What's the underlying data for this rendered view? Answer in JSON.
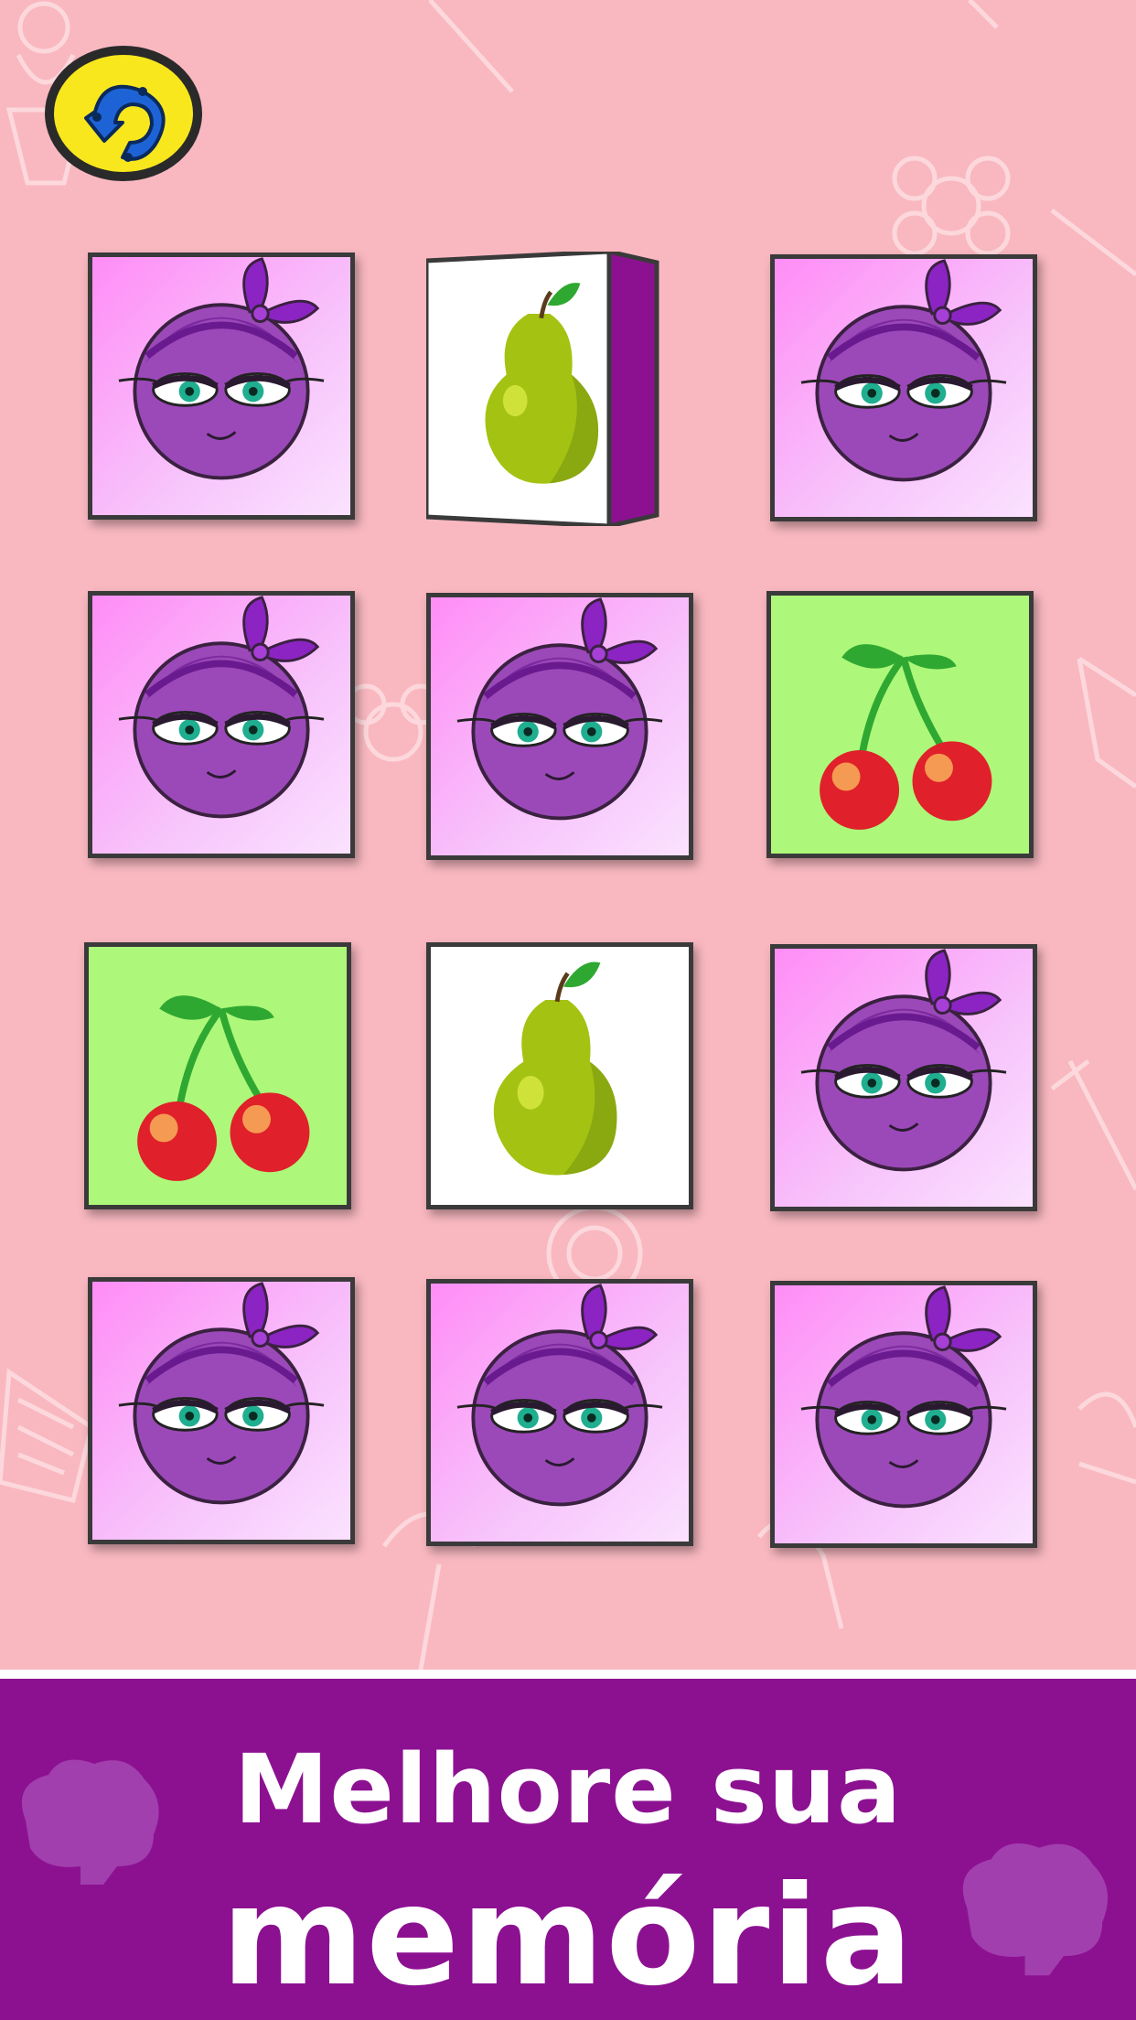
{
  "game": {
    "back_button_icon": "undo-arrow-icon",
    "board": {
      "rows": 4,
      "cols": 3,
      "cards": [
        {
          "state": "hidden",
          "face": "blueberry-girl"
        },
        {
          "state": "flipping",
          "face": "pear"
        },
        {
          "state": "hidden",
          "face": "blueberry-girl"
        },
        {
          "state": "hidden",
          "face": "blueberry-girl"
        },
        {
          "state": "hidden",
          "face": "blueberry-girl"
        },
        {
          "state": "revealed",
          "face": "cherry"
        },
        {
          "state": "revealed",
          "face": "cherry"
        },
        {
          "state": "revealed",
          "face": "pear"
        },
        {
          "state": "hidden",
          "face": "blueberry-girl"
        },
        {
          "state": "hidden",
          "face": "blueberry-girl"
        },
        {
          "state": "hidden",
          "face": "blueberry-girl"
        },
        {
          "state": "hidden",
          "face": "blueberry-girl"
        }
      ]
    }
  },
  "banner": {
    "line1": "Melhore sua",
    "line2": "memória"
  },
  "colors": {
    "background": "#f9b8c0",
    "band": "#8c1191",
    "card_back_pink": "#ff8df6",
    "cherry_card": "#adf87a",
    "back_button": "#f8e71c"
  }
}
